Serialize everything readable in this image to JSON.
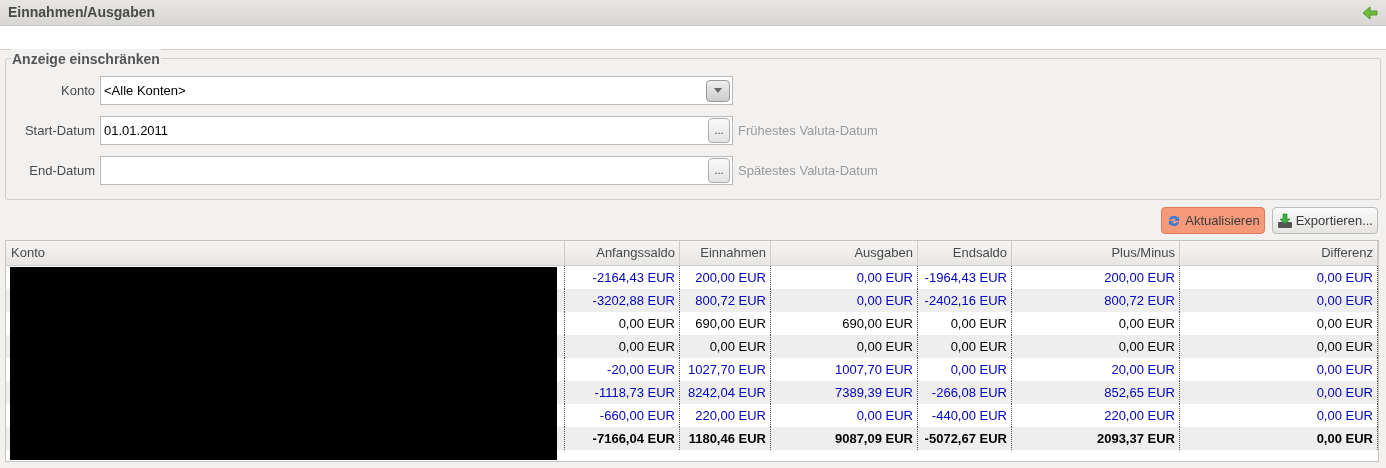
{
  "title": "Einnahmen/Ausgaben",
  "filter": {
    "title": "Anzeige einschränken",
    "fields": [
      {
        "kind": "select",
        "label": "Konto",
        "value": "<Alle Konten>"
      },
      {
        "kind": "date",
        "label": "Start-Datum",
        "value": "01.01.2011",
        "button": "...",
        "hint": "Frühestes Valuta-Datum"
      },
      {
        "kind": "date",
        "label": "End-Datum",
        "button": "...",
        "hint": "Spätestes Valuta-Datum"
      }
    ]
  },
  "buttons": [
    {
      "label": "Aktualisieren",
      "kind": "refresh",
      "selected": true
    },
    {
      "label": "Exportieren...",
      "kind": "export",
      "selected": false
    }
  ],
  "table": {
    "columns": [
      "Konto",
      "Anfangssaldo",
      "Einnahmen",
      "Ausgaben",
      "Endsaldo",
      "Plus/Minus",
      "Differenz"
    ],
    "rows": [
      {
        "color": "#0000c0",
        "bold": false,
        "cells": [
          "",
          "-2164,43 EUR",
          "200,00 EUR",
          "0,00 EUR",
          "-1964,43 EUR",
          "200,00 EUR",
          "0,00 EUR"
        ]
      },
      {
        "color": "#0000c0",
        "bold": false,
        "cells": [
          "",
          "-3202,88 EUR",
          "800,72 EUR",
          "0,00 EUR",
          "-2402,16 EUR",
          "800,72 EUR",
          "0,00 EUR"
        ]
      },
      {
        "color": "#000000",
        "bold": false,
        "cells": [
          "",
          "0,00 EUR",
          "690,00 EUR",
          "690,00 EUR",
          "0,00 EUR",
          "0,00 EUR",
          "0,00 EUR"
        ]
      },
      {
        "color": "#000000",
        "bold": false,
        "cells": [
          "",
          "0,00 EUR",
          "0,00 EUR",
          "0,00 EUR",
          "0,00 EUR",
          "0,00 EUR",
          "0,00 EUR"
        ]
      },
      {
        "color": "#0000c0",
        "bold": false,
        "cells": [
          "",
          "-20,00 EUR",
          "1027,70 EUR",
          "1007,70 EUR",
          "0,00 EUR",
          "20,00 EUR",
          "0,00 EUR"
        ]
      },
      {
        "color": "#0000c0",
        "bold": false,
        "cells": [
          "",
          "-1118,73 EUR",
          "8242,04 EUR",
          "7389,39 EUR",
          "-266,08 EUR",
          "852,65 EUR",
          "0,00 EUR"
        ]
      },
      {
        "color": "#0000c0",
        "bold": false,
        "cells": [
          "",
          "-660,00 EUR",
          "220,00 EUR",
          "0,00 EUR",
          "-440,00 EUR",
          "220,00 EUR",
          "0,00 EUR"
        ]
      },
      {
        "color": "#000000",
        "bold": true,
        "cells": [
          "",
          "-7166,04 EUR",
          "1180,46 EUR",
          "9087,09 EUR",
          "-5072,67 EUR",
          "2093,37 EUR",
          "0,00 EUR"
        ]
      }
    ]
  }
}
